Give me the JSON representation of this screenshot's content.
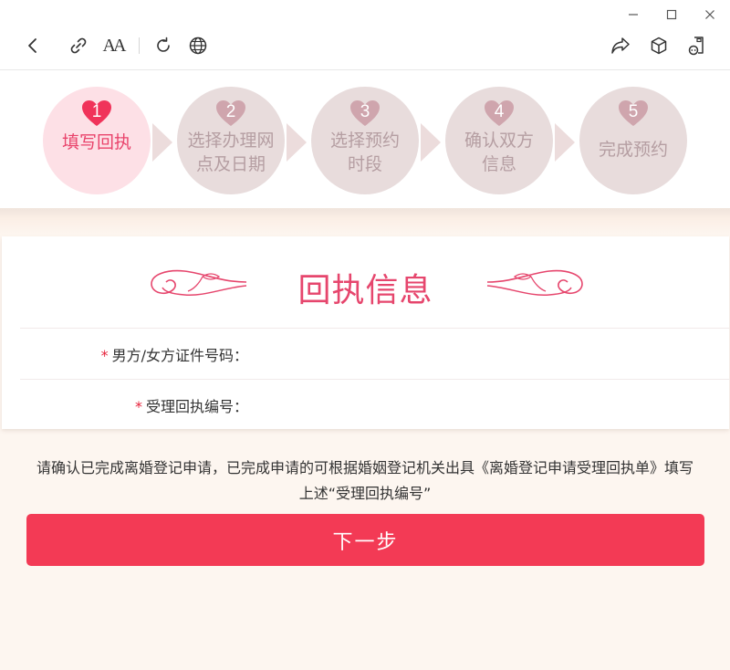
{
  "window": {
    "controls": [
      "minimize",
      "maximize",
      "close"
    ]
  },
  "toolbar": {
    "left_icons": [
      "back-icon",
      "link-icon",
      "font-size-icon",
      "refresh-icon",
      "globe-icon"
    ],
    "right_icons": [
      "share-icon",
      "cube-icon",
      "mini-program-icon"
    ],
    "font_size_glyph": "AA"
  },
  "steps": [
    {
      "number": "1",
      "label_line1": "填写回执",
      "label_line2": "",
      "active": true
    },
    {
      "number": "2",
      "label_line1": "选择办理网",
      "label_line2": "点及日期",
      "active": false
    },
    {
      "number": "3",
      "label_line1": "选择预约",
      "label_line2": "时段",
      "active": false
    },
    {
      "number": "4",
      "label_line1": "确认双方",
      "label_line2": "信息",
      "active": false
    },
    {
      "number": "5",
      "label_line1": "完成预约",
      "label_line2": "",
      "active": false
    }
  ],
  "colors": {
    "accent": "#e6466d",
    "step_active_bg": "#fde0e6",
    "step_inactive_bg": "#e8dcdc",
    "heart_active": "#f0335a",
    "heart_inactive": "#cfa5ad",
    "button_bg": "#f33a55",
    "page_bg": "#fdf6f0"
  },
  "card": {
    "title": "回执信息",
    "fields": [
      {
        "required_mark": "*",
        "label": "男方/女方证件号码：",
        "value": "",
        "placeholder": ""
      },
      {
        "required_mark": "*",
        "label": "受理回执编号：",
        "value": "",
        "placeholder": ""
      }
    ]
  },
  "notice": {
    "line1": "请确认已完成离婚登记申请，已完成申请的可根据婚姻登记机关出具《离婚登记申请受理回执单》填写",
    "line2": "上述“受理回执编号”"
  },
  "next_button": {
    "label": "下一步"
  }
}
